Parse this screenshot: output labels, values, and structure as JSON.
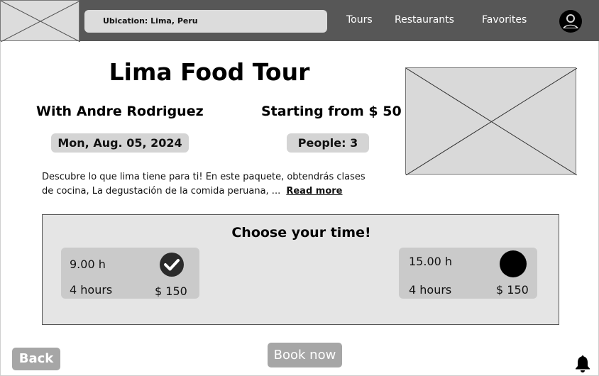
{
  "header": {
    "search_text": "Ubication: Lima, Peru",
    "nav": {
      "tours": "Tours",
      "restaurants": "Restaurants",
      "favorites": "Favorites"
    },
    "avatar_icon": "user-circle-icon"
  },
  "tour": {
    "title": "Lima Food Tour",
    "guide": "With Andre Rodriguez",
    "price": "Starting from $ 50",
    "date": "Mon, Aug. 05, 2024",
    "people": "People: 3",
    "description": "Descubre lo que lima tiene para ti! En este paquete, obtendrás clases de cocina, La degustación de la comida peruana, ...",
    "read_more": "Read more"
  },
  "times": {
    "title": "Choose your time!",
    "slots": [
      {
        "time": "9.00 h",
        "duration": "4 hours",
        "price": "$ 150",
        "selected": true
      },
      {
        "time": "15.00 h",
        "duration": "4 hours",
        "price": "$ 150",
        "selected": false
      }
    ]
  },
  "actions": {
    "back": "Back",
    "book": "Book now"
  },
  "icons": {
    "bell": "bell-icon",
    "check": "check-circle-icon",
    "radio": "radio-dot-icon"
  }
}
